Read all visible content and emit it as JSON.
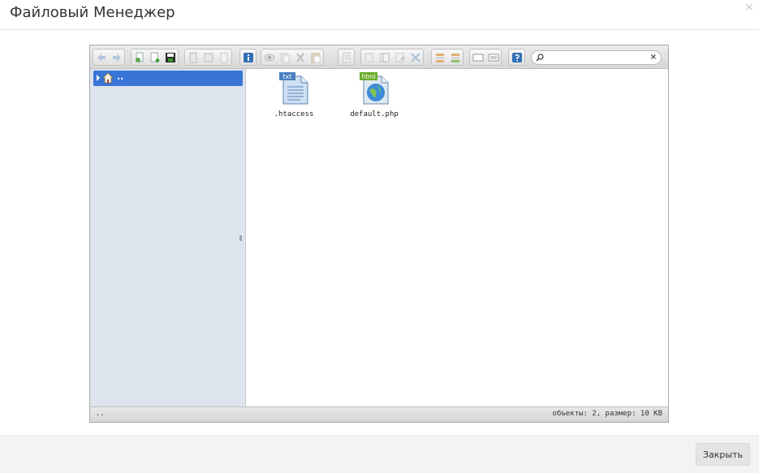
{
  "modal": {
    "title": "Файловый Менеджер",
    "close_glyph": "×",
    "footer_button": "Закрыть"
  },
  "toolbar": {
    "groups": [
      [
        "back-icon",
        "forward-icon"
      ],
      [
        "reload-icon",
        "new-file-icon",
        "save-icon"
      ],
      [
        "open-icon",
        "copy-file-icon",
        "download-icon"
      ],
      [
        "info-icon"
      ],
      [
        "preview-icon",
        "copy-icon",
        "cut-icon",
        "paste-icon"
      ],
      [
        "duplicate-icon"
      ],
      [
        "rename-icon",
        "edit-icon",
        "properties-icon",
        "resize-icon"
      ],
      [
        "archive-icon",
        "extract-icon"
      ],
      [
        "icons-view-icon",
        "list-view-icon"
      ],
      [
        "help-icon"
      ]
    ],
    "search": {
      "value": "",
      "placeholder": "",
      "clear_glyph": "×"
    }
  },
  "nav": {
    "items": [
      {
        "label": "..",
        "icon": "home-icon",
        "selected": true
      }
    ]
  },
  "files": [
    {
      "name": ".htaccess",
      "icon": "txt-file-icon",
      "badge": "txt"
    },
    {
      "name": "default.php",
      "icon": "html-file-icon",
      "badge": "html"
    }
  ],
  "statusbar": {
    "path": "..",
    "info": "объекты: 2, размер: 10 KB"
  },
  "colors": {
    "selection": "#3875d7",
    "nav_bg": "#dde4ee",
    "footer_bg": "#f3f3f3"
  }
}
